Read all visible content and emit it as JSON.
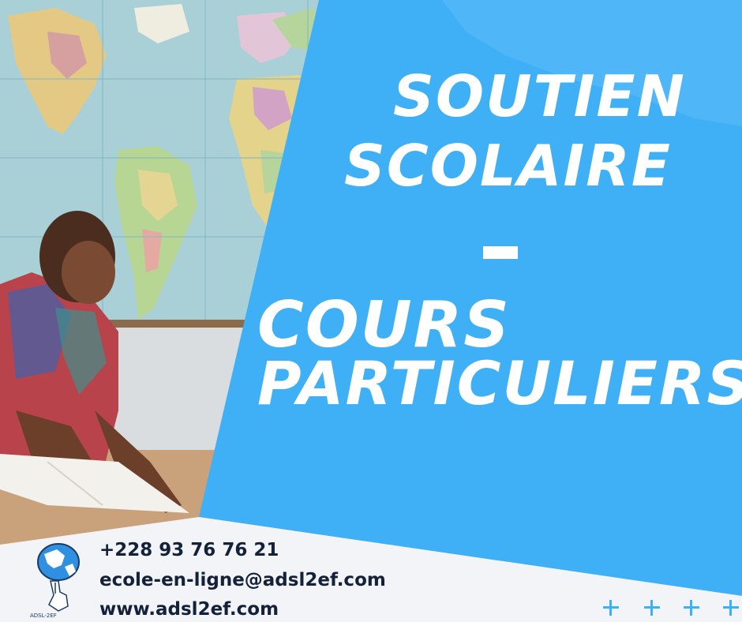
{
  "headline": {
    "line1": "SOUTIEN",
    "line2": "SCOLAIRE",
    "separator": "-",
    "line3": "COURS",
    "line4": "PARTICULIERS"
  },
  "contact": {
    "phone": "+228 93 76 76 21",
    "email": "ecole-en-ligne@adsl2ef.com",
    "website": "www.adsl2ef.com"
  },
  "logo": {
    "text": "ADSL-2EF",
    "icon": "globe-hand-logo"
  },
  "decorations": {
    "plus_count": 4,
    "icon": "plus-icon"
  },
  "colors": {
    "accent_blue": "#3fb0f6",
    "dark_text": "#14213a",
    "white": "#ffffff"
  }
}
